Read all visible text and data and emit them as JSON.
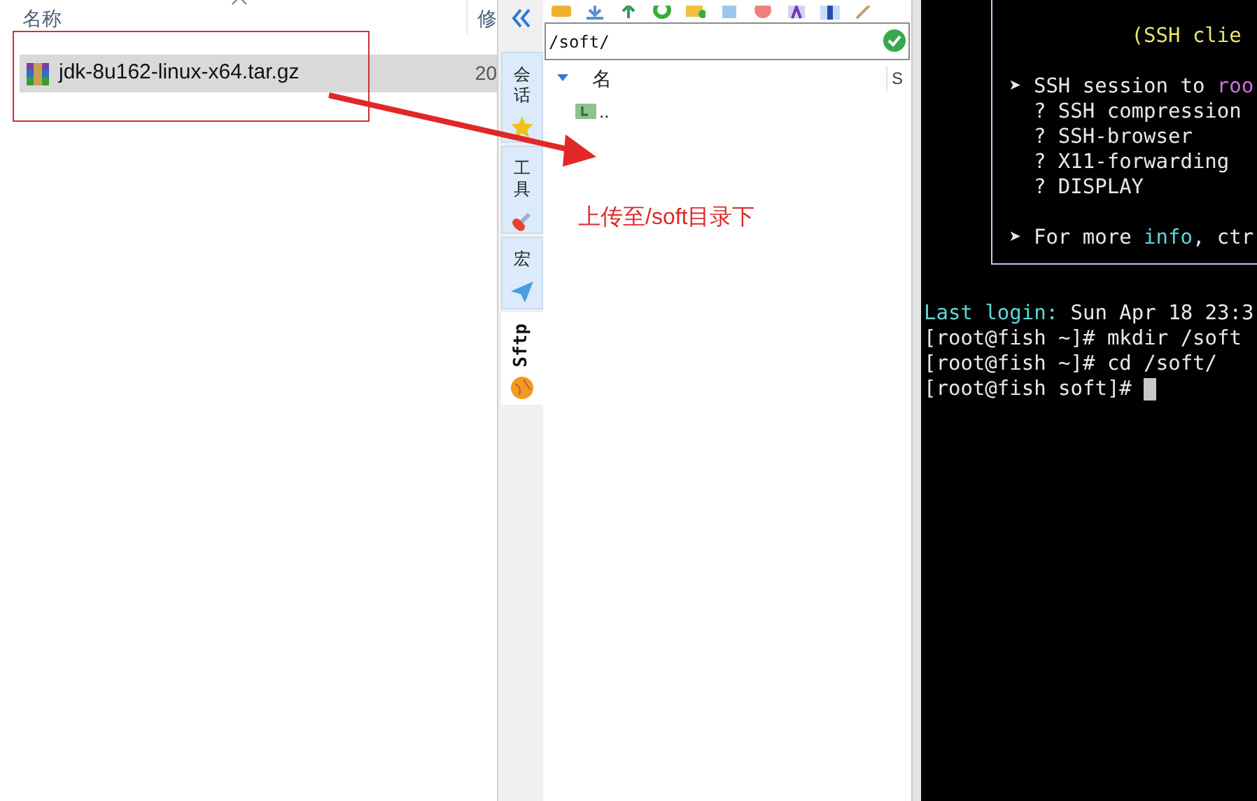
{
  "explorer": {
    "columns": [
      {
        "label": "名称"
      },
      {
        "label": "修"
      }
    ],
    "files": [
      {
        "name": "jdk-8u162-linux-x64.tar.gz",
        "date": "20",
        "selected": true
      }
    ]
  },
  "annotation": {
    "text": "上传至/soft目录下"
  },
  "sidebar": {
    "tabs": [
      {
        "label": "会话",
        "kind": "cjk",
        "selected": false
      },
      {
        "label": "工具",
        "kind": "cjk",
        "selected": false
      },
      {
        "label": "宏",
        "kind": "cjk",
        "selected": false
      },
      {
        "label": "Sftp",
        "kind": "latin",
        "selected": true
      }
    ]
  },
  "sftp": {
    "path": "/soft/",
    "columns": [
      {
        "label": "名"
      },
      {
        "label": "S"
      }
    ],
    "entries": [
      {
        "name": ".."
      }
    ]
  },
  "terminal": {
    "banner": [
      [
        [
          {
            "text": "          (SSH clie",
            "color": "#e8e36a"
          }
        ]
      ],
      [
        [
          {
            "text": "➤ SSH session to ",
            "color": "#e8e8e8"
          },
          {
            "text": "roo",
            "color": "#d070e0"
          }
        ],
        [
          {
            "text": "  ? SSH compression",
            "color": "#e8e8e8"
          }
        ],
        [
          {
            "text": "  ? SSH-browser",
            "color": "#e8e8e8"
          }
        ],
        [
          {
            "text": "  ? X11-forwarding",
            "color": "#e8e8e8"
          }
        ],
        [
          {
            "text": "  ? DISPLAY",
            "color": "#e8e8e8"
          }
        ]
      ],
      [
        [
          {
            "text": "➤ For more ",
            "color": "#e8e8e8"
          },
          {
            "text": "info",
            "color": "#5fd7d7"
          },
          {
            "text": ", ctr",
            "color": "#e8e8e8"
          }
        ]
      ]
    ],
    "lines": [
      [
        {
          "text": "Last login:",
          "color": "#5fd7d7"
        },
        {
          "text": " Sun Apr 18 23:3",
          "color": "#e8e8e8"
        }
      ],
      [
        {
          "text": "[root@fish ~]# mkdir /soft",
          "color": "#e8e8e8"
        }
      ],
      [
        {
          "text": "[root@fish ~]# cd /soft/",
          "color": "#e8e8e8"
        }
      ],
      [
        {
          "text": "[root@fish soft]# ",
          "color": "#e8e8e8"
        }
      ]
    ]
  }
}
